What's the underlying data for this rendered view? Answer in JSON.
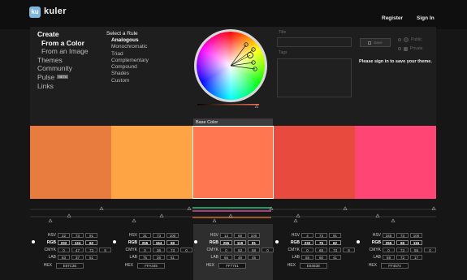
{
  "header": {
    "logo_mark": "ku",
    "logo_text": "kuler",
    "register": "Register",
    "signin": "Sign In"
  },
  "create_menu": {
    "heading": "Create",
    "from_color": "From a Color",
    "from_image": "From an Image",
    "themes": "Themes",
    "community": "Community",
    "pulse": "Pulse",
    "pulse_badge": "BETA",
    "links": "Links"
  },
  "rules": {
    "heading": "Select a Rule",
    "items": [
      "Analogous",
      "Monochromatic",
      "Triad",
      "Complementary",
      "Compound",
      "Shades",
      "Custom"
    ],
    "active_index": 0
  },
  "form": {
    "title_label": "Title",
    "tags_label": "Tags",
    "save_label": "Save",
    "public_label": "Public",
    "private_label": "Private",
    "signin_message": "Please sign in to save your theme."
  },
  "base_color_label": "Base Color",
  "value_labels": {
    "hsv": "HSV",
    "rgb": "RGB",
    "cmyk": "CMYK",
    "lab": "LAB",
    "hex": "HEX"
  },
  "selected_index": 2,
  "swatches": [
    {
      "color": "#E87C3E",
      "hsv": [
        "22",
        "73",
        "91"
      ],
      "rgb": [
        "232",
        "124",
        "62"
      ],
      "cmyk": [
        "0",
        "47",
        "73",
        "9"
      ],
      "lab": [
        "63",
        "37",
        "51"
      ],
      "hex": "E87C3E"
    },
    {
      "color": "#FFA445",
      "hsv": [
        "31",
        "73",
        "100"
      ],
      "rgb": [
        "255",
        "164",
        "69"
      ],
      "cmyk": [
        "0",
        "36",
        "73",
        "0"
      ],
      "lab": [
        "75",
        "26",
        "61"
      ],
      "hex": "FFA445"
    },
    {
      "color": "#FF7751",
      "hsv": [
        "13",
        "68",
        "100"
      ],
      "rgb": [
        "255",
        "119",
        "81"
      ],
      "cmyk": [
        "0",
        "53",
        "68",
        "0"
      ],
      "lab": [
        "66",
        "49",
        "45"
      ],
      "hex": "FF7751"
    },
    {
      "color": "#E84B3E",
      "hsv": [
        "4",
        "73",
        "91"
      ],
      "rgb": [
        "232",
        "75",
        "62"
      ],
      "cmyk": [
        "0",
        "68",
        "73",
        "9"
      ],
      "lab": [
        "55",
        "60",
        "41"
      ],
      "hex": "E84B3E"
    },
    {
      "color": "#FF4574",
      "hsv": [
        "345",
        "73",
        "100"
      ],
      "rgb": [
        "255",
        "69",
        "116"
      ],
      "cmyk": [
        "0",
        "73",
        "55",
        "0"
      ],
      "lab": [
        "59",
        "72",
        "17"
      ],
      "hex": "FF4574"
    }
  ]
}
